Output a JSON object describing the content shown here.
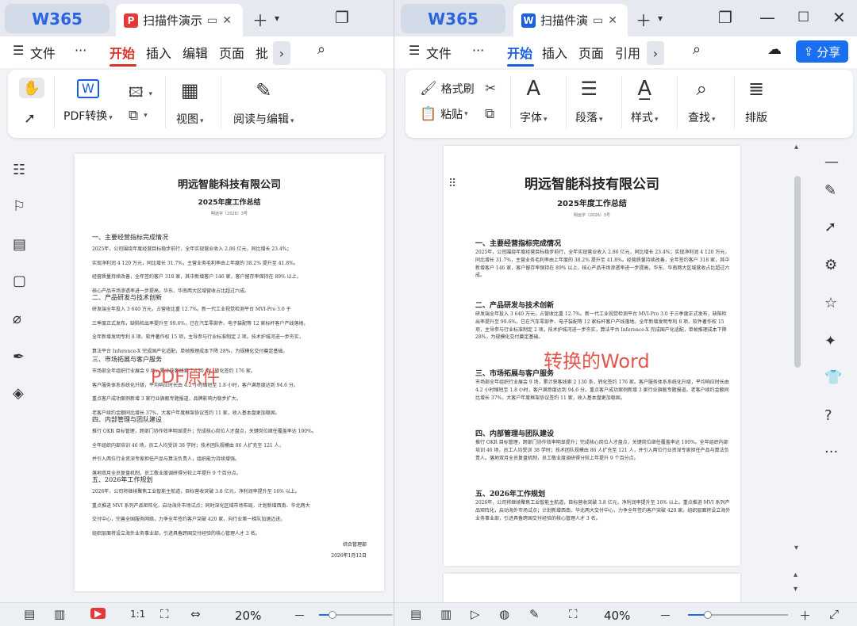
{
  "left_window": {
    "app_tab": "W365",
    "doc_tab": {
      "badge": "P",
      "title": "扫描件演示",
      "badge_color": "#e5383b"
    },
    "menu": {
      "file": "文件",
      "more": "···",
      "items": [
        "开始",
        "插入",
        "编辑",
        "页面",
        "批"
      ],
      "active": "开始"
    },
    "ribbon": {
      "pdf_convert": "PDF转换",
      "view": "视图",
      "read_edit": "阅读与编辑"
    },
    "doc": {
      "company": "明远智能科技有限公司",
      "title": "2025年度工作总结",
      "doc_no": "明远字〔2026〕3号",
      "sections": [
        {
          "heading": "一、主要经营指标完成情况",
          "lines": [
            "2025年，公司围绕年度经营目标稳步前行，全年实现营业收入 2.86 亿元，同比增长 23.4%；",
            "实现净利润 4 120 万元，同比增长 31.7%，主营业务毛利率由上年度的 38.2% 提升至 41.8%。",
            "经营质量持续改善，全年签约客户 318 家，其中新增客户 146 家，客户留存率保持在 89% 以上，",
            "核心产品市场渗透率进一步提高，华东、华南两大区域营收占比超过六成。"
          ]
        },
        {
          "heading": "二、产品研发与技术创新",
          "lines": [
            "研发端全年投入 3 640 万元，占营收比重 12.7%。新一代工业视觉检测平台 MVI-Pro 3.0 于",
            "三季度正式发布，缺陷检出率提升至 99.6%，已在汽车零部件、电子装配等 12 家标杆客户产线落地。",
            "全年新增发明专利 8 项、软件著作权 15 项，主导参与行业标准制定 2 项。技术护城河进一步夯实，",
            "算法平台 Inference-X 完成国产化适配，单帧推理成本下降 28%，为规模化交付奠定基础。"
          ]
        },
        {
          "heading": "三、市场拓展与客户服务",
          "lines": [
            "市场部全年组织行业展会 9 场，累计获客线索 2 130 条，转化签约 176 家。",
            "客户服务体系系统化升级，平均响应时长由 4.2 小时缩短至 1.8 小时，客户满意度达到 94.6 分。",
            "重点客户成功案例新增 3 家行业旗舰专题报道，品牌影响力稳步扩大。",
            "老客户续约金额同比增长 37%，大客户年度框架协议签约 11 家，收入基本盘更加稳固。"
          ]
        },
        {
          "heading": "四、内部管理与团队建设",
          "lines": [
            "推行 OKR 目标管理，跨部门协作效率明显提升；完成核心岗位人才盘点，关键岗位继任覆盖率达 100%。",
            "全年组织内部培训 46 场，员工人均受训 38 学时；技术团队规模由 86 人扩充至 121 人，",
            "并引入两位行业资深专家担任产品与算法负责人，组织能力持续增强。",
            "落地双月全员复盘机制，员工敬业度调研得分较上年提升 9 个百分点。"
          ]
        },
        {
          "heading": "五、2026年工作规划",
          "lines": [
            "2026年，公司将继续聚焦工业智能主航道，目标营收突破 3.8 亿元，净利润率提升至 16% 以上。",
            "重点推进 MVI 系列产品矩阵化，启动海外市场试点；同时深化区域市场布局，计划新增西南、华北两大",
            "交付中心，完善全国服务网络，力争全年签约客户突破 420 家，向行业第一梯队加速迈进。",
            "组织层面将设立海外业务事业部，引进具备跨国交付经验的核心管理人才 3 名。"
          ]
        }
      ],
      "signature": "综合管理部",
      "date": "2026年1月12日",
      "overlay": "PDF原件"
    },
    "status": {
      "zoom": "20%",
      "zoom_fraction": 0.18
    }
  },
  "right_window": {
    "app_tab": "W365",
    "doc_tab": {
      "badge": "W",
      "title": "扫描件演",
      "badge_color": "#1a5fe0"
    },
    "menu": {
      "file": "文件",
      "more": "···",
      "items": [
        "开始",
        "插入",
        "页面",
        "引用"
      ],
      "active": "开始"
    },
    "share": "分享",
    "ribbon": {
      "format_painter": "格式刷",
      "paste": "粘贴",
      "font": "字体",
      "paragraph": "段落",
      "style": "样式",
      "find": "查找",
      "layout": "排版"
    },
    "doc": {
      "company": "明远智能科技有限公司",
      "title": "2025年度工作总结",
      "doc_no": "明远字〔2026〕3号",
      "sections": [
        {
          "heading": "一、主要经营指标完成情况",
          "text": "2025年，公司围绕年度经营目标稳步前行，全年实现营业收入 2.86 亿元，同比增长 23.4%；实现净利润 4 120 万元，同比增长 31.7%，主营业务毛利率由上年度的 38.2% 提升至 41.8%。经营质量持续改善，全年签约客户 318 家，其中新增客户 146 家，客户留存率保持在 89% 以上，核心产品市场渗透率进一步提高，华东、华南两大区域营收占比超过六成。"
        },
        {
          "heading": "二、产品研发与技术创新",
          "text": "研发端全年投入 3 640 万元，占营收比重 12.7%。新一代工业视觉检测平台 MVI-Pro 3.0 于三季度正式发布，缺陷检出率提升至 99.6%，已在汽车零部件、电子装配等 12 家标杆客户产线落地。全年新增发明专利 8 项、软件著作权 15 项，主导参与行业标准制定 2 项。技术护城河进一步夯实，算法平台 Inference-X 完成国产化适配，单帧推理成本下降 28%，为规模化交付奠定基础。"
        },
        {
          "heading": "三、市场拓展与客户服务",
          "text": "市场部全年组织行业展会 9 场，累计获客线索 2 130 条，转化签约 176 家。客户服务体系系统化升级，平均响应时长由 4.2 小时缩短至 1.8 小时，客户满意度达到 94.6 分。重点客户成功案例新增 3 家行业旗舰专题报道。老客户续约金额同比增长 37%，大客户年度框架协议签约 11 家，收入基本盘更加稳固。"
        },
        {
          "heading": "四、内部管理与团队建设",
          "text": "推行 OKR 目标管理，跨部门协作效率明显提升；完成核心岗位人才盘点，关键岗位继任覆盖率达 100%。全年组织内部培训 46 场，员工人均受训 38 学时；技术团队规模由 86 人扩充至 121 人，并引入两位行业资深专家担任产品与算法负责人。落地双月全员复盘机制，员工敬业度调研得分较上年提升 9 个百分点。"
        },
        {
          "heading": "五、2026年工作规划",
          "text": "2026年，公司将继续聚焦工业智能主航道，目标营收突破 3.8 亿元，净利润率提升至 16% 以上。重点推进 MVI 系列产品矩阵化，启动海外市场试点；计划新增西南、华北两大交付中心，力争全年签约客户突破 420 家。组织层面将设立海外业务事业部，引进具备跨国交付经验的核心管理人才 3 名。"
        }
      ],
      "overlay": "转换的Word"
    },
    "status": {
      "zoom": "40%",
      "zoom_fraction": 0.2
    }
  },
  "colors": {
    "wps_red": "#d93025",
    "wps_blue": "#1a5fe0",
    "overlay_red": "#e0443a"
  }
}
